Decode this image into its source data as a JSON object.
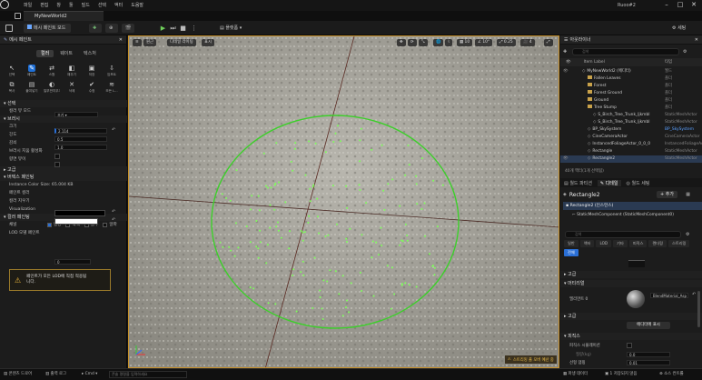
{
  "menu": {
    "items": [
      "파일",
      "편집",
      "창",
      "툴",
      "빌드",
      "선택",
      "액터",
      "도움말"
    ],
    "project": "Ruoo#2"
  },
  "tab": {
    "title": "MyNewWorld2"
  },
  "toolbar": {
    "mode": "메시 페인트 모드",
    "platform": "플랫폼",
    "settings": "세팅"
  },
  "viewport": {
    "perspective": "원근",
    "lit": "디테일 라이팅",
    "show": "표시",
    "snap_angle": "10°",
    "scale": "0.25",
    "grid": "10",
    "speed": "4",
    "warning": "스트리밍 풀 오버 예산 중"
  },
  "left_panel": {
    "title": "메시 페인트",
    "tabs": [
      "컬러",
      "웨이트",
      "텍스처"
    ],
    "tools": [
      {
        "label": "선택",
        "icon": "cursor-icon"
      },
      {
        "label": "페인트",
        "icon": "brush-icon"
      },
      {
        "label": "스왑",
        "icon": "swap-icon"
      },
      {
        "label": "채우기",
        "icon": "bucket-icon"
      },
      {
        "label": "저장",
        "icon": "save-icon"
      },
      {
        "label": "임포트",
        "icon": "import-icon"
      },
      {
        "label": "복사",
        "icon": "copy-icon"
      },
      {
        "label": "붙여넣기",
        "icon": "paste-icon"
      },
      {
        "label": "일부만지우기",
        "icon": "partial-erase-icon"
      },
      {
        "label": "삭제",
        "icon": "delete-icon"
      },
      {
        "label": "수정",
        "icon": "fix-icon"
      },
      {
        "label": "모든 L...",
        "icon": "all-lod-icon"
      }
    ],
    "sec_select": "선택",
    "select_mode_label": "컬러 뷰 모드",
    "select_mode_value": "끄기",
    "sec_brush": "브러시",
    "size_label": "크기",
    "size_value": "2.114",
    "strength_label": "강도",
    "strength_value": "0.5",
    "falloff_label": "감쇠",
    "falloff_value": "1.0",
    "enable_label": "브러시 지움 활성화",
    "remove_label": "향면 뷰이",
    "sec_advanced": "고급",
    "sec_vertex": "버텍스 페인팅",
    "instance_info": "Instance Color Size: 65.004 KB",
    "paint_color_label": "페인트 컬러",
    "erase_color_label": "컬러 지우기",
    "visualization": "Visualization",
    "sec_color": "컬러 페인팅",
    "channel_label": "채널",
    "channels": [
      "빨강",
      "녹색",
      "블루",
      "알파"
    ],
    "lod_label": "LOD 모델 페인트",
    "lod_value": "0",
    "warning": "페인트가 모든 LOD에 직접 적용됩니다."
  },
  "outliner": {
    "title": "아웃라이너",
    "search_placeholder": "검색",
    "col_label": "Item Label",
    "col_type": "타입",
    "items": [
      {
        "name": "MyNewWorld2 (에디터)",
        "type": "월드",
        "depth": 0,
        "folder": false
      },
      {
        "name": "Fallen Leaves",
        "type": "폴더",
        "depth": 1,
        "folder": true
      },
      {
        "name": "Forest",
        "type": "폴더",
        "depth": 1,
        "folder": true
      },
      {
        "name": "Forest Ground",
        "type": "폴더",
        "depth": 1,
        "folder": true
      },
      {
        "name": "Ground",
        "type": "폴더",
        "depth": 1,
        "folder": true
      },
      {
        "name": "Tree Stump",
        "type": "폴더",
        "depth": 1,
        "folder": true
      },
      {
        "name": "S_Birch_Tree_Trunk_ljkmbl",
        "type": "StaticMeshActor",
        "depth": 2,
        "folder": false
      },
      {
        "name": "S_Birch_Tree_Trunk_ljkmbl",
        "type": "StaticMeshActor",
        "depth": 2,
        "folder": false
      },
      {
        "name": "BP_SkySystem",
        "type": "BP_SkySystem",
        "depth": 1,
        "folder": false
      },
      {
        "name": "CineCameraActor",
        "type": "CineCameraActor",
        "depth": 1,
        "folder": false
      },
      {
        "name": "InstancedFoliageActor_0_0_0",
        "type": "InstancedFoliageActor",
        "depth": 1,
        "folder": false
      },
      {
        "name": "Rectangle",
        "type": "StaticMeshActor",
        "depth": 1,
        "folder": false
      },
      {
        "name": "Rectangle2",
        "type": "StaticMeshActor",
        "depth": 1,
        "folder": false
      }
    ],
    "count": "40개 액터(1개 선택됨)"
  },
  "details": {
    "tab_world": "월드 파티션",
    "tab_details": "디테일",
    "tab_world_settings": "월드 세팅",
    "actor_name": "Rectangle2",
    "add_label": "+ 추가",
    "instance_row": "Rectangle2 (인스턴스)",
    "component_row": "StaticMeshComponent (StaticMeshComponent0)",
    "search_placeholder": "검색",
    "filter_tabs": [
      "일반",
      "액터",
      "LOD",
      "기타",
      "피직스",
      "렌더링",
      "스트리밍",
      "전체"
    ],
    "sec_advanced": "고급",
    "sec_material": "머티리얼",
    "element_label": "엘리먼트 0",
    "material_name": "BlendMaterial_Asp",
    "sec_advanced2": "고급",
    "button_label": "에디터에 표시",
    "sec_physics": "피직스",
    "physics_label": "피직스 시뮬레이션",
    "mass_label": "질량(kg)",
    "mass_value": "0.0",
    "damping_label": "선형 댐핑",
    "damping_value": "0.01"
  },
  "status": {
    "content_drawer": "콘텐츠 드로어",
    "output_log": "출력 로그",
    "cmd": "Cmd",
    "cmd_placeholder": "콘솔 명령을 입력하세요",
    "derived": "파생 데이터",
    "unsaved": "1 저장되지 않음",
    "source_control": "소스 컨트롤"
  }
}
